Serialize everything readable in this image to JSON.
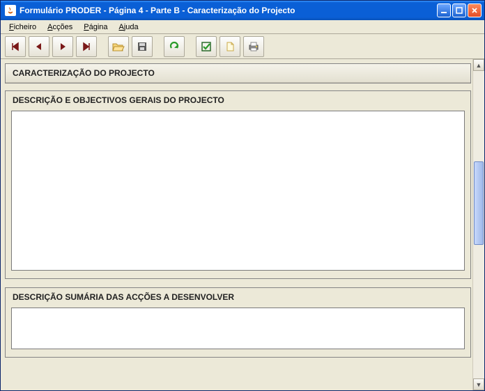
{
  "window": {
    "title": "Formulário PRODER - Página 4 - Parte B - Caracterização do Projecto"
  },
  "menubar": {
    "ficheiro": "Ficheiro",
    "accoes": "Acções",
    "pagina": "Página",
    "ajuda": "Ajuda"
  },
  "toolbar": {
    "first": "|◀",
    "prev": "◀",
    "next": "▶",
    "last": "▶|"
  },
  "main": {
    "panel_title": "CARACTERIZAÇÃO DO PROJECTO",
    "sections": [
      {
        "title": "DESCRIÇÃO E OBJECTIVOS GERAIS DO PROJECTO",
        "value": ""
      },
      {
        "title": "DESCRIÇÃO SUMÁRIA DAS ACÇÕES A DESENVOLVER",
        "value": ""
      }
    ]
  }
}
